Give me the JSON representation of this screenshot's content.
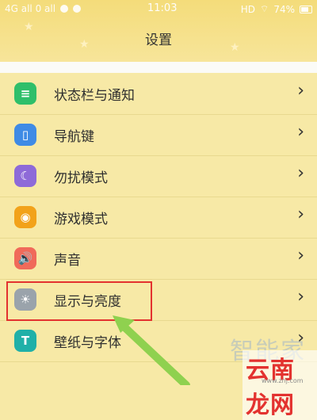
{
  "status_bar": {
    "left_text": "4G all  0 all",
    "time": "11:03",
    "right_text": "HD",
    "battery": "74%"
  },
  "header": {
    "title": "设置"
  },
  "settings": [
    {
      "label": "状态栏与通知",
      "icon": "notification-list-icon",
      "icon_color": "#2fbf6a"
    },
    {
      "label": "导航键",
      "icon": "navigation-keys-icon",
      "icon_color": "#3f8be5"
    },
    {
      "label": "勿扰模式",
      "icon": "moon-icon",
      "icon_color": "#8e6ad8"
    },
    {
      "label": "游戏模式",
      "icon": "game-icon",
      "icon_color": "#f2a21a"
    },
    {
      "label": "声音",
      "icon": "speaker-icon",
      "icon_color": "#f06a5a"
    },
    {
      "label": "显示与亮度",
      "icon": "sun-icon",
      "icon_color": "#9aa3ab"
    },
    {
      "label": "壁纸与字体",
      "icon": "wallpaper-font-icon",
      "icon_color": "#20b0a8"
    }
  ],
  "watermark": {
    "line1": "智能家",
    "line2": "云南龙网",
    "url": "www.znj.com"
  }
}
